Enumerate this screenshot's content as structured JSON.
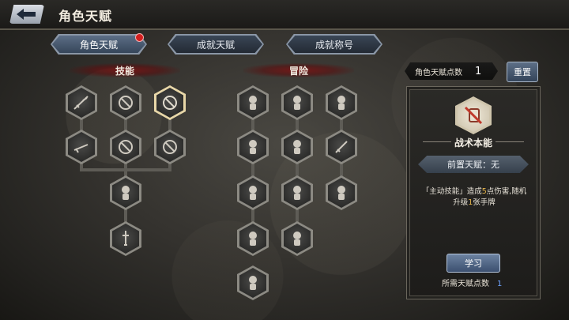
{
  "header": {
    "title": "角色天赋",
    "back_icon": "back-arrow-icon"
  },
  "tabs": [
    {
      "label": "角色天赋",
      "active": true,
      "has_badge": true
    },
    {
      "label": "成就天赋",
      "active": false
    },
    {
      "label": "成就称号",
      "active": false
    }
  ],
  "sections": {
    "skills": "技能",
    "adventure": "冒险"
  },
  "points": {
    "label": "角色天赋点数",
    "value": "1"
  },
  "reset_label": "重置",
  "detail": {
    "name": "战术本能",
    "prerequisite": "前置天赋：无",
    "desc_parts": [
      "「主动技能」造成",
      "5",
      "点伤害,随机升级",
      "1",
      "张手牌"
    ],
    "learn_label": "学习",
    "cost_label": "所需天赋点数",
    "cost_value": "1"
  },
  "colors": {
    "accent_blue": "#6fa3ff",
    "highlight": "#e6b54a",
    "badge_red": "#d41f1f"
  }
}
